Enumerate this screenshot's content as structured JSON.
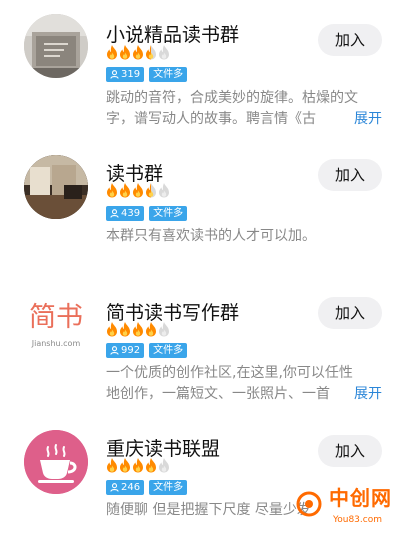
{
  "groups": [
    {
      "name": "小说精品读书群",
      "flames": [
        1,
        1,
        1,
        0.5,
        0
      ],
      "members": "319",
      "files_label": "文件多",
      "desc_lines": [
        "跳动的音符，合成美妙的旋律。枯燥的文",
        "字，谱写动人的故事。聘言情《古"
      ],
      "expand": "展开",
      "join": "加入"
    },
    {
      "name": "读书群",
      "flames": [
        1,
        1,
        1,
        0.5,
        0
      ],
      "members": "439",
      "files_label": "文件多",
      "desc_lines": [
        "本群只有喜欢读书的人才可以加。"
      ],
      "expand": "",
      "join": "加入"
    },
    {
      "name": "简书读书写作群",
      "flames": [
        1,
        1,
        1,
        1,
        0
      ],
      "members": "992",
      "files_label": "文件多",
      "desc_lines": [
        "一个优质的创作社区,在这里,你可以任性",
        "地创作，一篇短文、一张照片、一首"
      ],
      "expand": "展开",
      "join": "加入",
      "logo_main": "简书",
      "logo_sub": "Jianshu.com"
    },
    {
      "name": "重庆读书联盟",
      "flames": [
        1,
        1,
        1,
        1,
        0
      ],
      "members": "246",
      "files_label": "文件多",
      "desc_lines": [
        "随便聊 但是把握下尺度 尽量少发"
      ],
      "expand": "",
      "join": "加入"
    }
  ],
  "colors": {
    "flame_active": "#ff8a00",
    "flame_inactive": "#d9d9d9",
    "badge": "#3aa5ea",
    "link": "#2b86d8",
    "watermark": "#ff6a00"
  },
  "watermark": {
    "text": "中创网",
    "sub": "You83.com"
  }
}
